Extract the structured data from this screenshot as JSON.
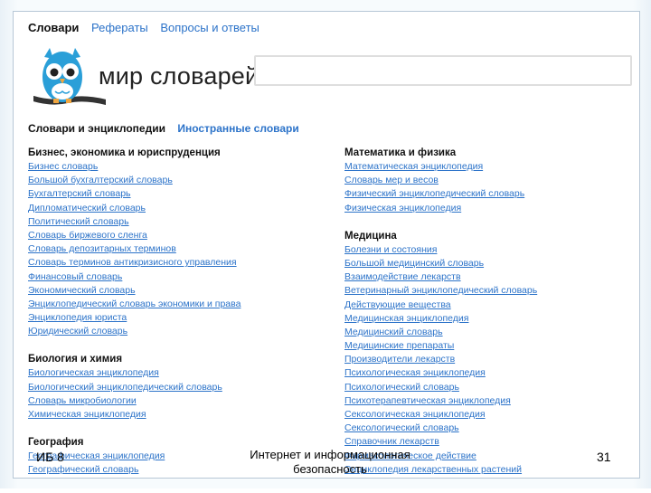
{
  "topnav": {
    "active": "Словари",
    "links": [
      "Рефераты",
      "Вопросы и ответы"
    ]
  },
  "branding": {
    "title": "мир словарей",
    "logo_icon": "owl-logo-icon",
    "brand_color": "#2a9fd8"
  },
  "search": {
    "placeholder": ""
  },
  "tabs": {
    "active": "Словари и энциклопедии",
    "link": "Иностранные словари"
  },
  "columns": {
    "left": [
      {
        "heading": "Бизнес, экономика и юриспруденция",
        "items": [
          "Бизнес словарь",
          "Большой бухгалтерский словарь",
          "Бухгалтерский словарь",
          "Дипломатический словарь",
          "Политический словарь",
          "Словарь биржевого сленга",
          "Словарь депозитарных терминов",
          "Словарь терминов антикризисного управления",
          "Финансовый словарь",
          "Экономический словарь",
          "Энциклопедический словарь экономики и права",
          "Энциклопедия юриста",
          "Юридический словарь"
        ]
      },
      {
        "heading": "Биология и химия",
        "items": [
          "Биологическая энциклопедия",
          "Биологический энциклопедический словарь",
          "Словарь микробиологии",
          "Химическая энциклопедия"
        ]
      },
      {
        "heading": "География",
        "items": [
          "Географическая энциклопедия",
          "Географический словарь"
        ]
      }
    ],
    "right": [
      {
        "heading": "Математика и физика",
        "items": [
          "Математическая энциклопедия",
          "Словарь мер и весов",
          "Физический энциклопедический словарь",
          "Физическая энциклопедия"
        ]
      },
      {
        "heading": "Медицина",
        "items": [
          "Болезни и состояния",
          "Большой медицинский словарь",
          "Взаимодействие лекарств",
          "Ветеринарный энциклопедический словарь",
          "Действующие вещества",
          "Медицинская энциклопедия",
          "Медицинский словарь",
          "Медицинские препараты",
          "Производители лекарств",
          "Психологическая энциклопедия",
          "Психологический словарь",
          "Психотерапевтическая энциклопедия",
          "Сексологическая энциклопедия",
          "Сексологический словарь",
          "Справочник лекарств",
          "Фармакологическое действие",
          "Энциклопедия лекарственных растений"
        ]
      }
    ]
  },
  "footer": {
    "left": "ИБ 8",
    "center": "Интернет и информационная безопасность",
    "right": "31"
  }
}
